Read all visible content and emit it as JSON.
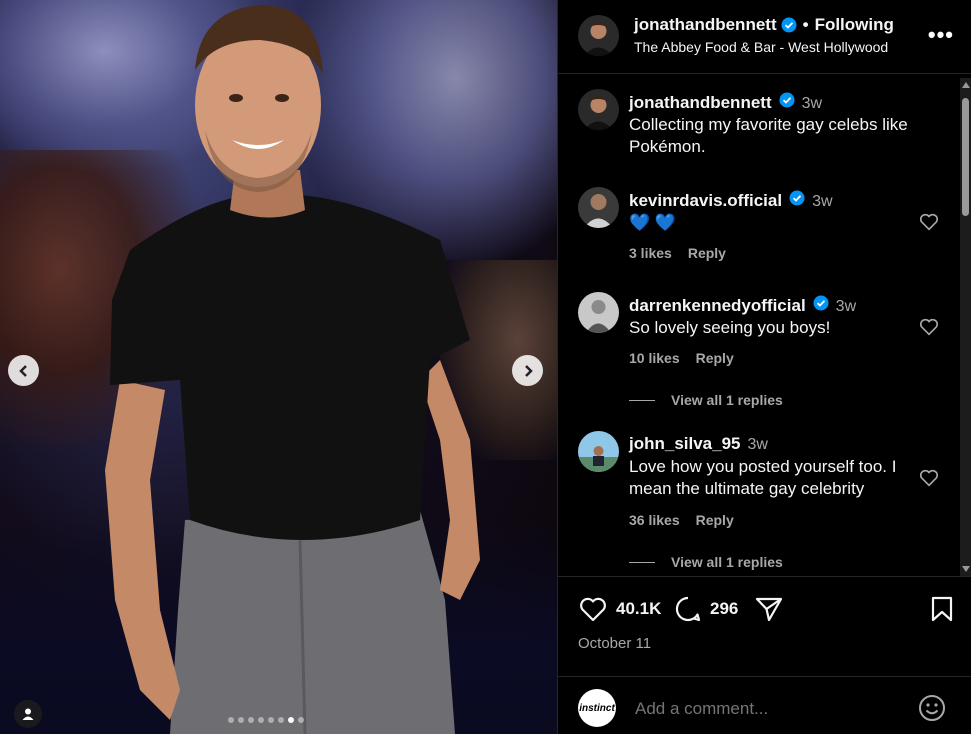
{
  "post": {
    "carousel": {
      "total_slides": 8,
      "active_index": 6
    },
    "header": {
      "username": "jonathandbennett",
      "follow_status": "Following",
      "location": "The Abbey Food & Bar - West Hollywood",
      "more_icon": "more-horizontal-icon"
    },
    "caption": {
      "username": "jonathandbennett",
      "time": "3w",
      "text": "Collecting my favorite gay celebs like Pokémon."
    },
    "comments": [
      {
        "username": "kevinrdavis.official",
        "verified": true,
        "time": "3w",
        "text": "💙 💙",
        "likes": "3 likes",
        "reply": "Reply"
      },
      {
        "username": "darrenkennedyofficial",
        "verified": true,
        "time": "3w",
        "text": "So lovely seeing you boys!",
        "likes": "10 likes",
        "reply": "Reply",
        "view_replies": "View all 1 replies"
      },
      {
        "username": "john_silva_95",
        "verified": false,
        "time": "3w",
        "text": "Love how you posted yourself too. I mean the ultimate gay celebrity",
        "likes": "36 likes",
        "reply": "Reply",
        "view_replies": "View all 1 replies"
      }
    ],
    "actions": {
      "like_count": "40.1K",
      "comment_count": "296",
      "date": "October 11"
    },
    "add_comment": {
      "avatar_text": "instinct",
      "placeholder": "Add a comment..."
    },
    "colors": {
      "verified_blue": "#0095f6",
      "heart_emoji_blue": "#3f8ff0",
      "secondary_text": "#a8a8a8"
    }
  }
}
